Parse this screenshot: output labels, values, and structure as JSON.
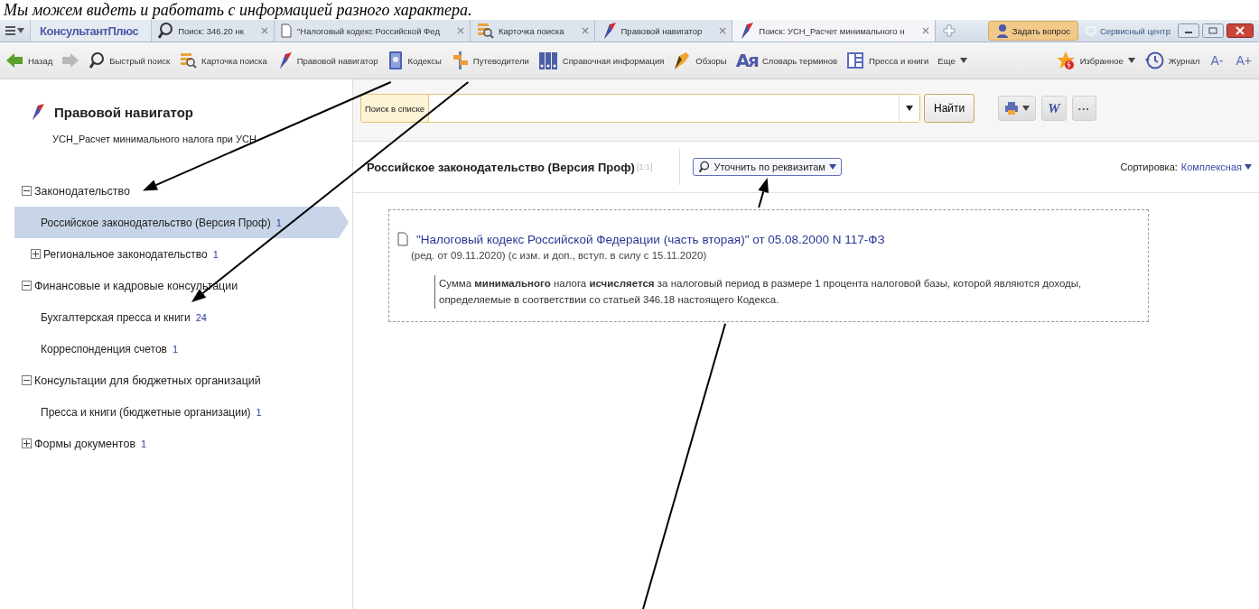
{
  "caption": "Мы можем видеть и работать с информацией разного характера.",
  "tabbar": {
    "logo": "КонсультантПлюс",
    "tabs": [
      {
        "label": "Поиск: 346.20 нк",
        "kind": "search",
        "selected": false
      },
      {
        "label": "\"Налоговый кодекс Российской Фед",
        "kind": "doc",
        "selected": false
      },
      {
        "label": "Карточка поиска",
        "kind": "card",
        "selected": false
      },
      {
        "label": "Правовой навигатор",
        "kind": "navigator",
        "selected": false
      },
      {
        "label": "Поиск: УСН_Расчет минимального н",
        "kind": "navigator",
        "selected": true
      }
    ],
    "ask": "Задать вопрос",
    "service": "Сервисный центр"
  },
  "toolbar": {
    "items": [
      {
        "kind": "back",
        "label": "Назад"
      },
      {
        "kind": "forward"
      },
      {
        "kind": "search",
        "label": "Быстрый поиск"
      },
      {
        "kind": "card",
        "label": "Карточка поиска"
      },
      {
        "kind": "navigator",
        "label": "Правовой навигатор"
      },
      {
        "kind": "codes",
        "label": "Кодексы"
      },
      {
        "kind": "guides",
        "label": "Путеводители"
      },
      {
        "kind": "reference",
        "label": "Справочная информация"
      },
      {
        "kind": "reviews",
        "label": "Обзоры"
      },
      {
        "kind": "dictionary",
        "icon_text": "Ая",
        "label": "Словарь терминов"
      },
      {
        "kind": "press",
        "label": "Пресса и книги"
      },
      {
        "kind": "more",
        "label": "Еще"
      }
    ],
    "right": [
      {
        "kind": "favorites",
        "label": "Избранное"
      },
      {
        "kind": "journal",
        "label": "Журнал"
      },
      {
        "kind": "font",
        "label": "A-"
      },
      {
        "kind": "font",
        "label": "A+"
      }
    ]
  },
  "sidebar": {
    "title": "Правовой навигатор",
    "subtitle": "УСН_Расчет минимального налога при УСН",
    "tree": [
      {
        "label": "Законодательство",
        "expanded": true,
        "children": [
          {
            "label": "Российское законодательство (Версия Проф)",
            "count": "1",
            "selected": true
          },
          {
            "label": "Региональное законодательство",
            "count": "1",
            "expanded": false,
            "selected": false
          }
        ]
      },
      {
        "label": "Финансовые и кадровые консультации",
        "expanded": true,
        "children": [
          {
            "label": "Бухгалтерская пресса и книги",
            "count": "24",
            "selected": false
          },
          {
            "label": "Корреспонденция счетов",
            "count": "1",
            "selected": false
          }
        ]
      },
      {
        "label": "Консультации для бюджетных организаций",
        "expanded": true,
        "children": [
          {
            "label": "Пресса и книги (бюджетные организации)",
            "count": "1",
            "selected": false
          }
        ]
      },
      {
        "label": "Формы документов",
        "count": "1",
        "expanded": false
      }
    ]
  },
  "main": {
    "search": {
      "label": "Поиск в списке",
      "button": "Найти"
    },
    "tools": [
      {
        "kind": "print"
      },
      {
        "kind": "word",
        "icon_text": "W"
      },
      {
        "kind": "more",
        "icon_text": "···"
      }
    ],
    "header": {
      "title": "Российское законодательство (Версия Проф)",
      "counter": "[1:1]",
      "refine": "Уточнить по реквизитам",
      "sort_label": "Сортировка:",
      "sort_value": "Комплексная"
    },
    "results": [
      {
        "title": "\"Налоговый кодекс Российской Федерации (часть вторая)\" от 05.08.2000 N 117-ФЗ",
        "meta": "(ред. от 09.11.2020) (с изм. и доп., вступ. в силу с 15.11.2020)",
        "snippet": "Сумма **минимального** налога **исчисляется** за налоговый период в размере 1 процента налоговой базы, которой являются доходы, определяемые в соответствии со статьей 346.18 настоящего Кодекса."
      }
    ]
  }
}
